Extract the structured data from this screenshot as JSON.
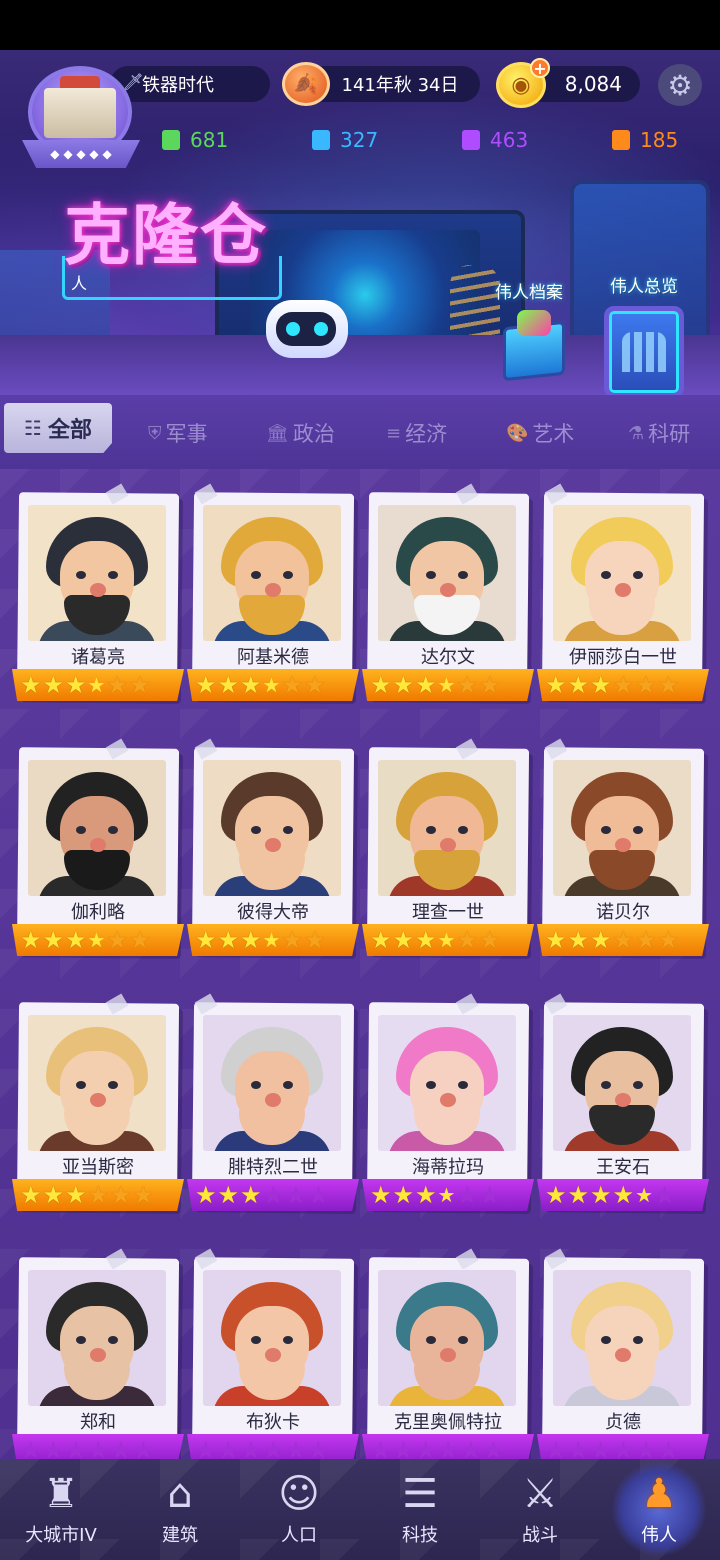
{
  "topbar": {
    "era": "铁器时代",
    "date": "141年秋 34日",
    "coins": "8,084"
  },
  "resources": [
    {
      "value": "681",
      "color": "#5bd85b"
    },
    {
      "value": "327",
      "color": "#3ab8ff"
    },
    {
      "value": "463",
      "color": "#b04cff"
    },
    {
      "value": "185",
      "color": "#ff8a1c"
    }
  ],
  "banner": {
    "title": "克隆仓",
    "subtitle": "人",
    "archive_label": "伟人档案",
    "overview_label": "伟人总览"
  },
  "tabs": [
    {
      "label": "全部",
      "icon": "grid-icon",
      "active": true
    },
    {
      "label": "军事",
      "icon": "shield-icon"
    },
    {
      "label": "政治",
      "icon": "building-icon"
    },
    {
      "label": "经济",
      "icon": "coins-icon"
    },
    {
      "label": "艺术",
      "icon": "palette-icon"
    },
    {
      "label": "科研",
      "icon": "flask-icon"
    }
  ],
  "cards": [
    {
      "name": "诸葛亮",
      "stars": 3.5,
      "frame": "orange"
    },
    {
      "name": "阿基米德",
      "stars": 3.5,
      "frame": "orange"
    },
    {
      "name": "达尔文",
      "stars": 3.5,
      "frame": "orange"
    },
    {
      "name": "伊丽莎白一世",
      "stars": 3,
      "frame": "orange"
    },
    {
      "name": "伽利略",
      "stars": 3.5,
      "frame": "orange"
    },
    {
      "name": "彼得大帝",
      "stars": 3.5,
      "frame": "orange"
    },
    {
      "name": "理查一世",
      "stars": 3.5,
      "frame": "orange"
    },
    {
      "name": "诺贝尔",
      "stars": 3,
      "frame": "orange"
    },
    {
      "name": "亚当斯密",
      "stars": 3,
      "frame": "orange"
    },
    {
      "name": "腓特烈二世",
      "stars": 3,
      "frame": "purple"
    },
    {
      "name": "海蒂拉玛",
      "stars": 3.5,
      "frame": "purple"
    },
    {
      "name": "王安石",
      "stars": 4.5,
      "frame": "purple"
    },
    {
      "name": "郑和",
      "stars": 0,
      "frame": "purple"
    },
    {
      "name": "布狄卡",
      "stars": 0,
      "frame": "purple"
    },
    {
      "name": "克里奥佩特拉",
      "stars": 0,
      "frame": "purple"
    },
    {
      "name": "贞德",
      "stars": 0,
      "frame": "purple"
    }
  ],
  "nav": [
    {
      "label": "大城市IV",
      "icon": "castle-icon"
    },
    {
      "label": "建筑",
      "icon": "house-icon"
    },
    {
      "label": "人口",
      "icon": "person-icon"
    },
    {
      "label": "科技",
      "icon": "book-icon"
    },
    {
      "label": "战斗",
      "icon": "crossed-swords-icon"
    },
    {
      "label": "伟人",
      "icon": "great-person-icon",
      "active": true
    }
  ]
}
